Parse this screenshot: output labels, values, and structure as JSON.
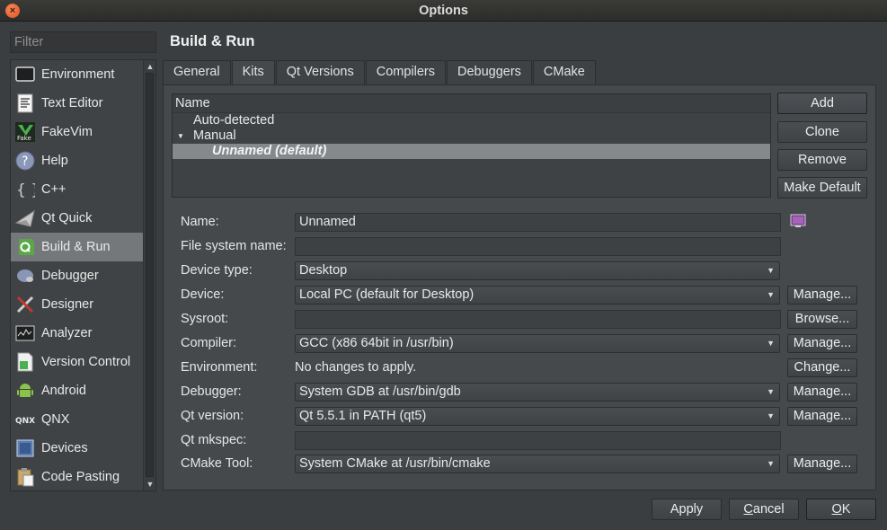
{
  "window": {
    "title": "Options",
    "close_glyph": "×"
  },
  "sidebar": {
    "filter_placeholder": "Filter",
    "items": [
      {
        "label": "Environment",
        "icon": "monitor-icon"
      },
      {
        "label": "Text Editor",
        "icon": "text-editor-icon"
      },
      {
        "label": "FakeVim",
        "icon": "fakevim-icon"
      },
      {
        "label": "Help",
        "icon": "help-icon"
      },
      {
        "label": "C++",
        "icon": "braces-icon"
      },
      {
        "label": "Qt Quick",
        "icon": "qt-quick-icon"
      },
      {
        "label": "Build & Run",
        "icon": "build-run-icon",
        "selected": true
      },
      {
        "label": "Debugger",
        "icon": "debugger-icon"
      },
      {
        "label": "Designer",
        "icon": "designer-icon"
      },
      {
        "label": "Analyzer",
        "icon": "analyzer-icon"
      },
      {
        "label": "Version Control",
        "icon": "version-control-icon"
      },
      {
        "label": "Android",
        "icon": "android-icon"
      },
      {
        "label": "QNX",
        "icon": "qnx-icon"
      },
      {
        "label": "Devices",
        "icon": "devices-icon"
      },
      {
        "label": "Code Pasting",
        "icon": "code-pasting-icon"
      }
    ]
  },
  "main": {
    "title": "Build & Run",
    "tabs": [
      {
        "label": "General"
      },
      {
        "label": "Kits",
        "active": true
      },
      {
        "label": "Qt Versions"
      },
      {
        "label": "Compilers"
      },
      {
        "label": "Debuggers"
      },
      {
        "label": "CMake"
      }
    ],
    "kit_tree": {
      "header": "Name",
      "rows": [
        {
          "label": "Auto-detected"
        },
        {
          "label": "Manual",
          "expand_glyph": "▼"
        },
        {
          "label": "Unnamed (default)",
          "selected": true
        }
      ]
    },
    "kit_buttons": {
      "add": "Add",
      "clone": "Clone",
      "remove": "Remove",
      "make_default": "Make Default"
    },
    "form": {
      "name_label": "Name:",
      "name_value": "Unnamed",
      "fs_name_label": "File system name:",
      "fs_name_value": "",
      "device_type_label": "Device type:",
      "device_type_value": "Desktop",
      "device_label": "Device:",
      "device_value": "Local PC (default for Desktop)",
      "sysroot_label": "Sysroot:",
      "sysroot_value": "",
      "compiler_label": "Compiler:",
      "compiler_value": "GCC (x86 64bit in /usr/bin)",
      "environment_label": "Environment:",
      "environment_value": "No changes to apply.",
      "debugger_label": "Debugger:",
      "debugger_value": "System GDB at /usr/bin/gdb",
      "qt_version_label": "Qt version:",
      "qt_version_value": "Qt 5.5.1 in PATH (qt5)",
      "qt_mkspec_label": "Qt mkspec:",
      "qt_mkspec_value": "",
      "cmake_tool_label": "CMake Tool:",
      "cmake_tool_value": "System CMake at /usr/bin/cmake",
      "combo_arrow": "▼",
      "manage_label": "Manage...",
      "browse_label": "Browse...",
      "change_label": "Change..."
    }
  },
  "footer": {
    "apply": "Apply",
    "cancel_u": "C",
    "cancel_rest": "ancel",
    "ok_u": "O",
    "ok_rest": "K"
  }
}
